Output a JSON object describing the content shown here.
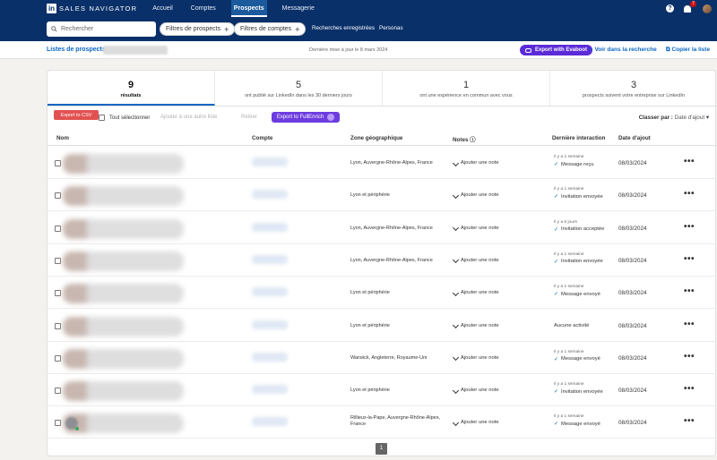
{
  "nav": {
    "logo_letters": "in",
    "brand": "SALES NAVIGATOR",
    "items": [
      "Accueil",
      "Comptes",
      "Prospects",
      "Messagerie"
    ],
    "active": "Prospects",
    "help": "?",
    "notif_count": "7"
  },
  "search": {
    "placeholder": "Rechercher",
    "lead_filters": "Filtres de prospects",
    "account_filters": "Filtres de comptes",
    "saved": "Recherches enregistrées",
    "personas": "Personas"
  },
  "subheader": {
    "title": "Listes de prospects",
    "updated": "Dernière mise à jour le 8 mars 2024",
    "evaboot": "Export with Evaboot",
    "view_search": "Voir dans la recherche",
    "copy_list": "Copier la liste"
  },
  "stats": [
    {
      "num": "9",
      "label": "résultats"
    },
    {
      "num": "5",
      "label": "ont publié sur LinkedIn dans les 30 derniers jours"
    },
    {
      "num": "1",
      "label": "ont une expérience en commun avec vous"
    },
    {
      "num": "3",
      "label": "prospects suivent votre entreprise sur LinkedIn"
    }
  ],
  "toolbar": {
    "export_csv": "Export to CSV",
    "select_all": "Tout sélectionner",
    "add_to_list": "Ajouter à une autre liste",
    "delete": "Retirer",
    "fullenrich": "Export to FullEnrich",
    "sort_label": "Classer par :",
    "sort_value": "Date d'ajout"
  },
  "table": {
    "headers": [
      "Nom",
      "Compte",
      "Zone géographique",
      "Notes",
      "Dernière interaction",
      "Date d'ajout"
    ],
    "add_note": "Ajouter une note",
    "rows": [
      {
        "zone": "Lyon, Auvergne-Rhône-Alpes, France",
        "ago": "Il y a 1 semaine",
        "action": "Message reçu",
        "date": "08/03/2024"
      },
      {
        "zone": "Lyon et périphérie",
        "ago": "Il y a 1 semaine",
        "action": "Invitation envoyée",
        "date": "08/03/2024"
      },
      {
        "zone": "Lyon, Auvergne-Rhône-Alpes, France",
        "ago": "Il y a 6 jours",
        "action": "Invitation acceptée",
        "date": "08/03/2024"
      },
      {
        "zone": "Lyon, Auvergne-Rhône-Alpes, France",
        "ago": "Il y a 1 semaine",
        "action": "Invitation envoyée",
        "date": "08/03/2024"
      },
      {
        "zone": "Lyon et périphérie",
        "ago": "Il y a 1 semaine",
        "action": "Message envoyé",
        "date": "08/03/2024"
      },
      {
        "zone": "Lyon et périphérie",
        "ago": "",
        "action": "Aucune activité",
        "date": "08/03/2024"
      },
      {
        "zone": "Warwick, Angleterre, Royaume-Uni",
        "ago": "Il y a 1 semaine",
        "action": "Message envoyé",
        "date": "08/03/2024"
      },
      {
        "zone": "Lyon et périphérie",
        "ago": "Il y a 1 semaine",
        "action": "Invitation envoyée",
        "date": "08/03/2024"
      },
      {
        "zone": "Rillieux-la-Pape, Auvergne-Rhône-Alpes, France",
        "ago": "Il y a 1 semaine",
        "action": "Message envoyé",
        "date": "08/03/2024"
      }
    ]
  },
  "pager": {
    "current": "1"
  },
  "colors": {
    "nav": "#0a3069",
    "accent": "#0a66c2",
    "evaboot": "#5b2bd8",
    "fullenrich": "#6d3ce0",
    "csv": "#e25151"
  }
}
